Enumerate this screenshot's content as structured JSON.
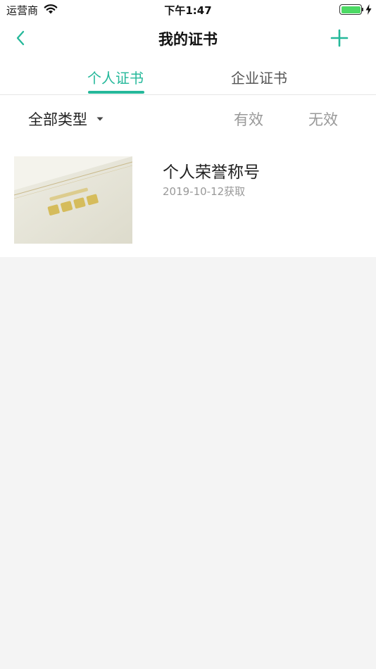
{
  "status_bar": {
    "carrier": "运营商",
    "time": "下午1:47"
  },
  "nav": {
    "title": "我的证书"
  },
  "tabs": [
    {
      "label": "个人证书",
      "active": true
    },
    {
      "label": "企业证书",
      "active": false
    }
  ],
  "filters": {
    "type_label": "全部类型",
    "valid_label": "有效",
    "invalid_label": "无效"
  },
  "certificates": [
    {
      "title": "个人荣誉称号",
      "date": "2019-10-12获取"
    }
  ],
  "icons": {
    "back": "chevron-left-icon",
    "add": "plus-icon",
    "dropdown": "caret-down-icon",
    "wifi": "wifi-icon",
    "battery": "battery-icon",
    "charging": "bolt-icon"
  },
  "colors": {
    "accent": "#25b89a",
    "battery": "#4cd964",
    "background": "#f4f4f4",
    "inactive_text": "#999999"
  }
}
